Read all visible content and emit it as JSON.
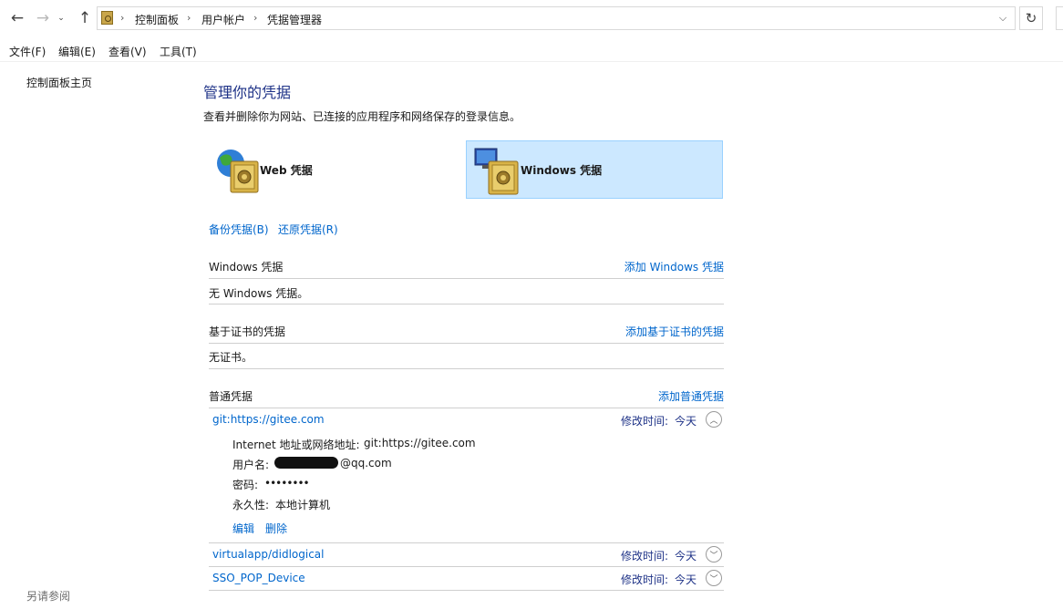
{
  "address": {
    "breadcrumb": [
      "控制面板",
      "用户帐户",
      "凭据管理器"
    ],
    "refresh_icon": "refresh-icon",
    "back_icon": "arrow-left-icon",
    "forward_icon": "arrow-right-icon",
    "up_icon": "arrow-up-icon"
  },
  "menu": [
    "文件(F)",
    "编辑(E)",
    "查看(V)",
    "工具(T)"
  ],
  "left_pane": {
    "home_link": "控制面板主页",
    "see_also": "另请参阅"
  },
  "main": {
    "title": "管理你的凭据",
    "description": "查看并删除你为网站、已连接的应用程序和网络保存的登录信息。",
    "tiles": [
      {
        "label": "Web 凭据",
        "icon": "web-vault-icon",
        "selected": false
      },
      {
        "label": "Windows 凭据",
        "icon": "windows-vault-icon",
        "selected": true
      }
    ],
    "backup_link": "备份凭据(B)",
    "restore_link": "还原凭据(R)",
    "sections": {
      "windows": {
        "title": "Windows 凭据",
        "add_link": "添加 Windows 凭据",
        "empty_text": "无 Windows 凭据。"
      },
      "certificate": {
        "title": "基于证书的凭据",
        "add_link": "添加基于证书的凭据",
        "empty_text": "无证书。"
      },
      "generic": {
        "title": "普通凭据",
        "add_link": "添加普通凭据",
        "modified_label": "修改时间:",
        "items": [
          {
            "name": "git:https://gitee.com",
            "modified": "今天",
            "expanded": true,
            "details": {
              "address_label": "Internet 地址或网络地址:",
              "address_value": "git:https://gitee.com",
              "username_label": "用户名:",
              "username_suffix": "@qq.com",
              "password_label": "密码:",
              "password_value": "••••••••",
              "persistence_label": "永久性:",
              "persistence_value": "本地计算机",
              "edit_link": "编辑",
              "delete_link": "删除"
            }
          },
          {
            "name": "virtualapp/didlogical",
            "modified": "今天",
            "expanded": false
          },
          {
            "name": "SSO_POP_Device",
            "modified": "今天",
            "expanded": false
          }
        ]
      }
    }
  },
  "colors": {
    "link": "#0066cc",
    "title": "#1e3287",
    "selected_tile_bg": "#cce8ff",
    "selected_tile_border": "#99d1ff"
  }
}
